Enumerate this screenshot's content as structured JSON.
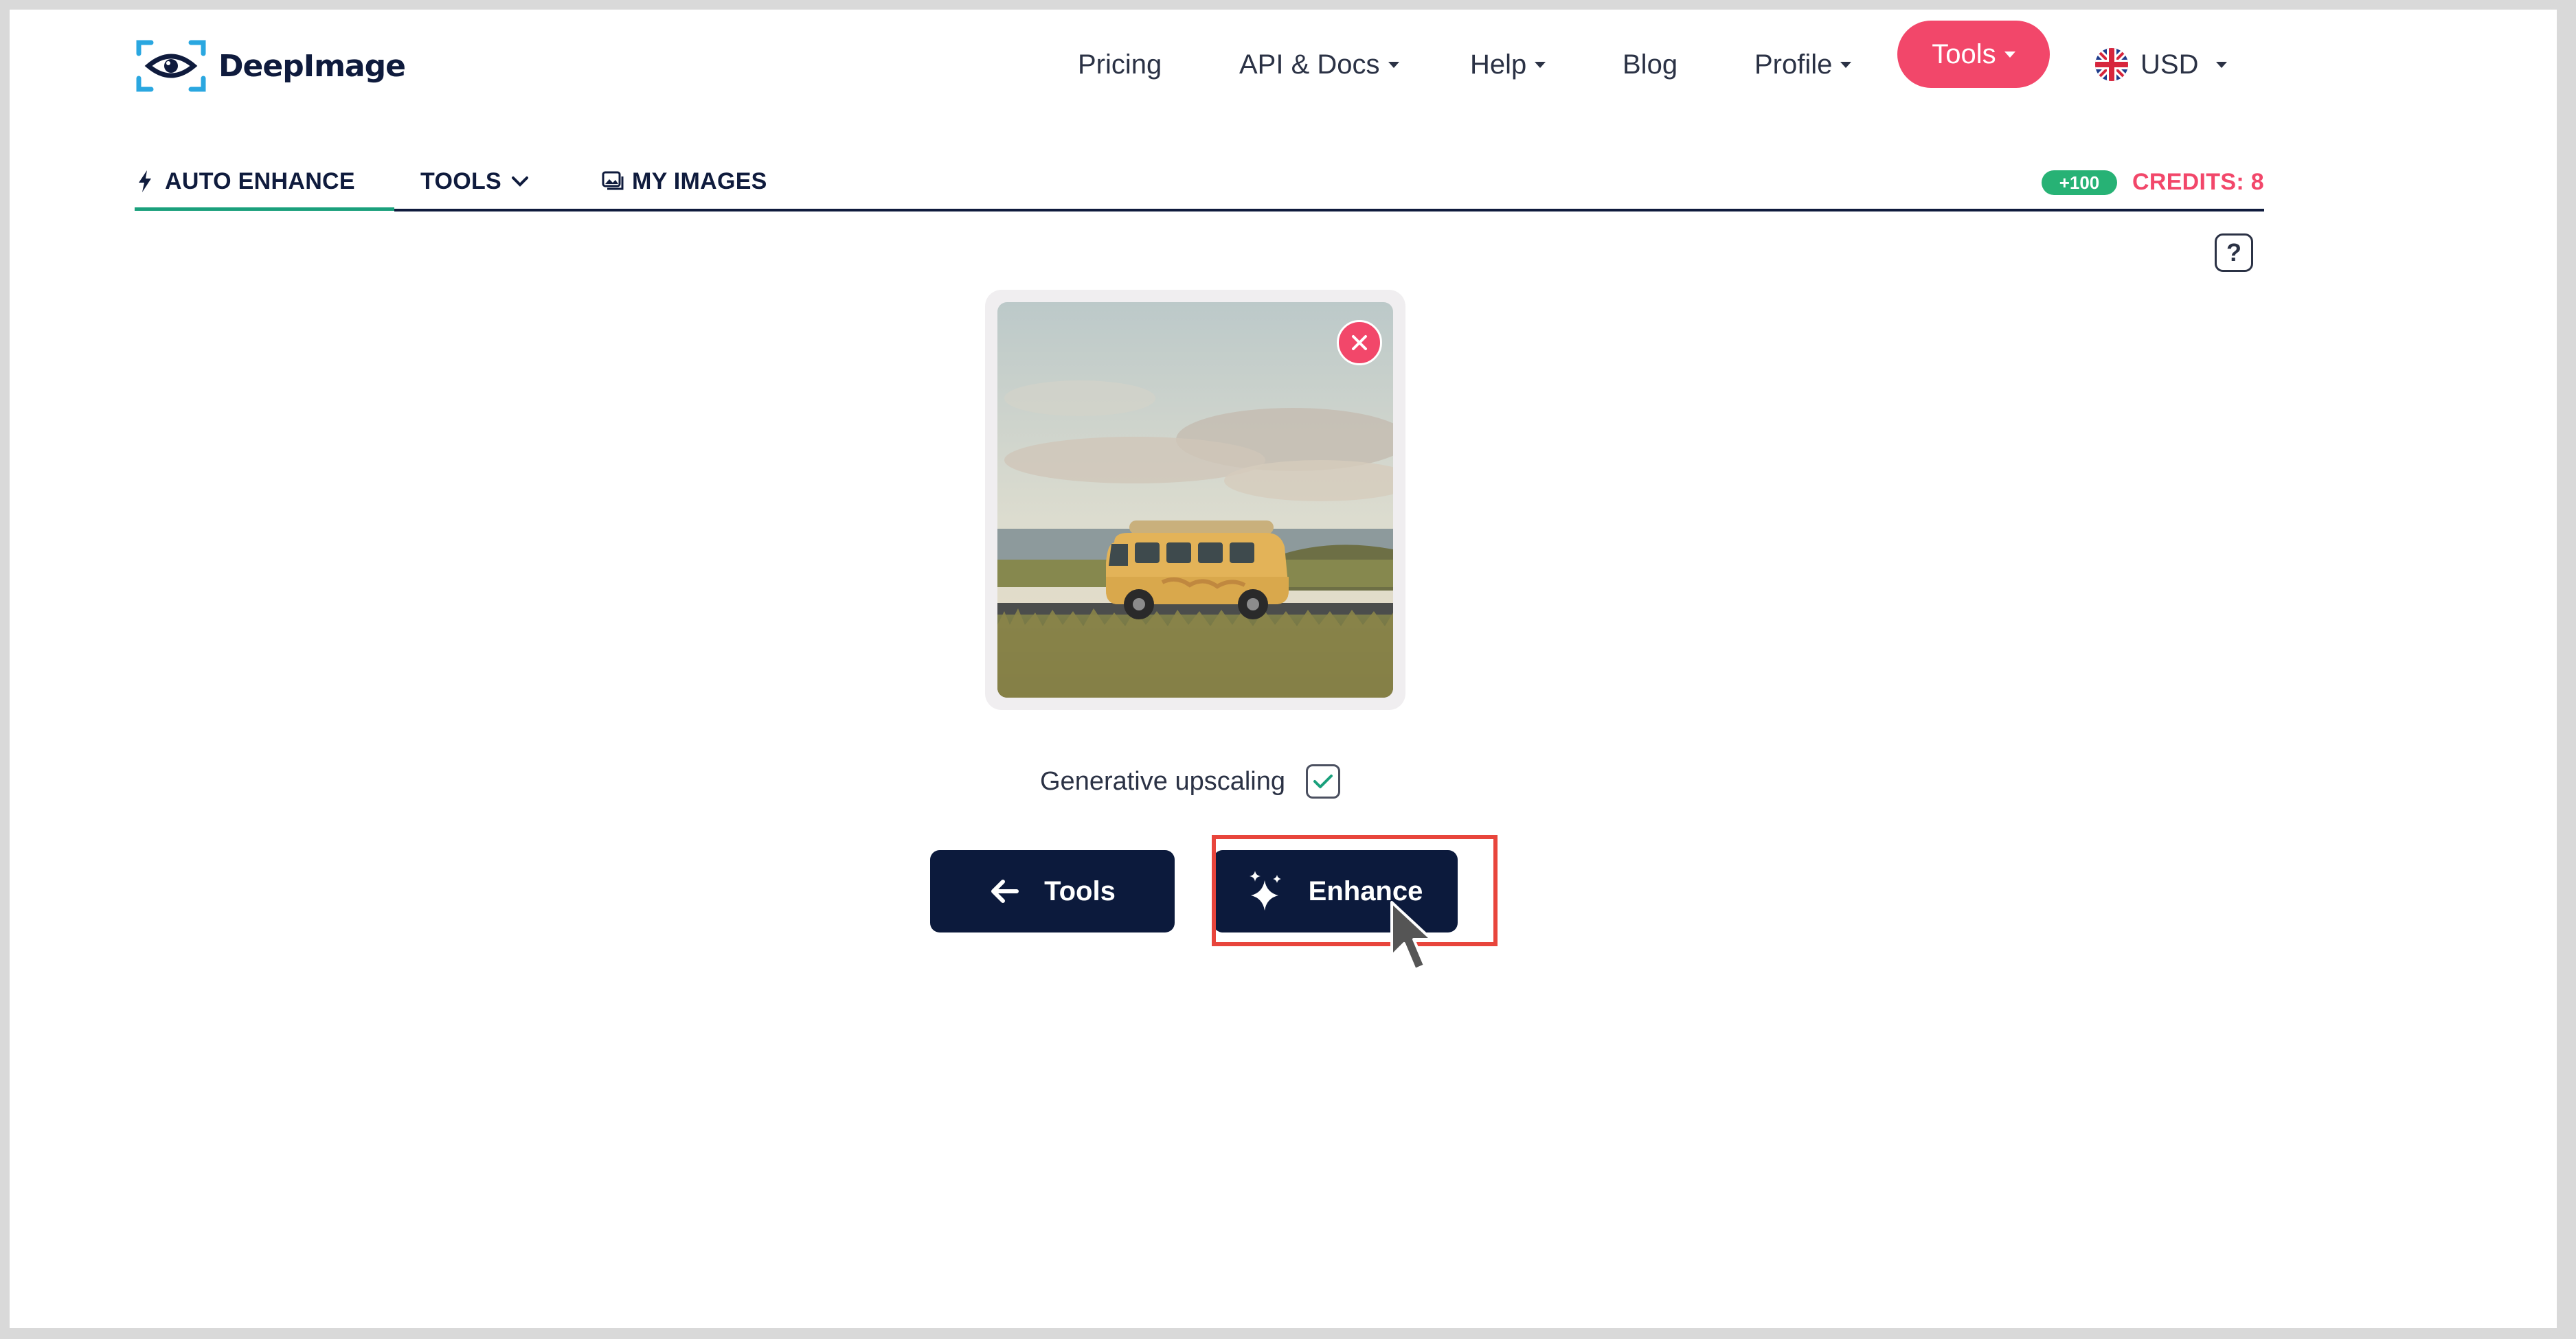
{
  "brand": {
    "name": "DeepImage"
  },
  "nav": {
    "items": [
      {
        "label": "Pricing",
        "dropdown": false
      },
      {
        "label": "API & Docs",
        "dropdown": true
      },
      {
        "label": "Help",
        "dropdown": true
      },
      {
        "label": "Blog",
        "dropdown": false
      },
      {
        "label": "Profile",
        "dropdown": true
      }
    ],
    "tools_label": "Tools",
    "currency": "USD"
  },
  "tabs": {
    "auto_enhance": "AUTO ENHANCE",
    "tools": "TOOLS",
    "my_images": "MY IMAGES",
    "active": "auto_enhance"
  },
  "credits": {
    "bonus": "+100",
    "label": "CREDITS: 8"
  },
  "help": {
    "label": "?"
  },
  "options": {
    "generative_upscaling": {
      "label": "Generative upscaling",
      "checked": true
    }
  },
  "buttons": {
    "back_label": "Tools",
    "enhance_label": "Enhance"
  },
  "colors": {
    "accent_pink": "#f2476a",
    "navy": "#0c1a3c",
    "active_tab": "#1aa07c",
    "badge_green": "#27b275",
    "highlight_red": "#e8453c"
  }
}
